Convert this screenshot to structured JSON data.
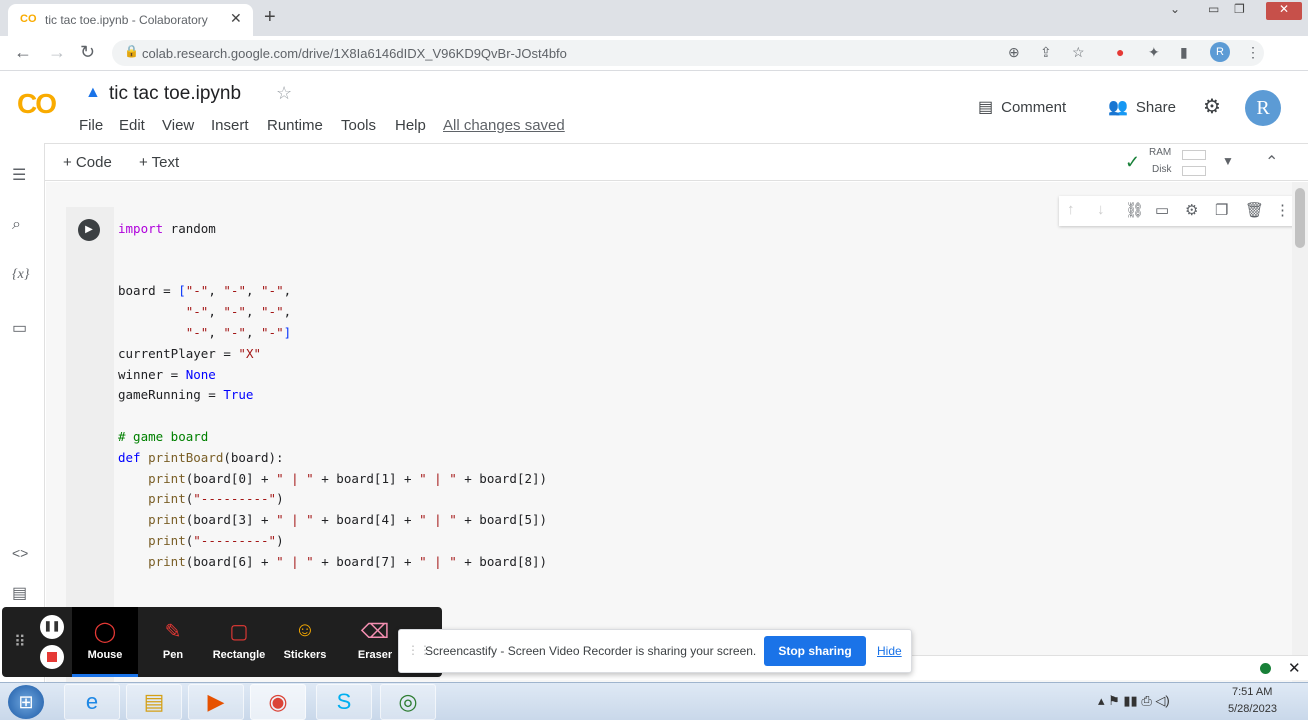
{
  "browser": {
    "tab_title": "tic tac toe.ipynb - Colaboratory",
    "tab_favicon": "CO",
    "url": "colab.research.google.com/drive/1X8Ia6146dIDX_V96KD9QvBr-JOst4bfo"
  },
  "colab": {
    "logo": "CO",
    "notebook_title": "tic tac toe.ipynb",
    "menu": [
      "File",
      "Edit",
      "View",
      "Insert",
      "Runtime",
      "Tools",
      "Help"
    ],
    "saved_status": "All changes saved",
    "comment_label": "Comment",
    "share_label": "Share",
    "avatar_letter": "R",
    "toolbar": {
      "add_code": "+ Code",
      "add_text": "+ Text",
      "ram_label": "RAM",
      "disk_label": "Disk"
    }
  },
  "cell": {
    "code_lines": [
      [
        [
          "kw",
          "import"
        ],
        [
          "",
          " random"
        ]
      ],
      [],
      [],
      [
        [
          "",
          "board = "
        ],
        [
          "br",
          "["
        ],
        [
          "str",
          "\"-\""
        ],
        [
          "",
          ", "
        ],
        [
          "str",
          "\"-\""
        ],
        [
          "",
          ", "
        ],
        [
          "str",
          "\"-\""
        ],
        [
          "",
          ","
        ]
      ],
      [
        [
          "",
          "         "
        ],
        [
          "str",
          "\"-\""
        ],
        [
          "",
          ", "
        ],
        [
          "str",
          "\"-\""
        ],
        [
          "",
          ", "
        ],
        [
          "str",
          "\"-\""
        ],
        [
          "",
          ","
        ]
      ],
      [
        [
          "",
          "         "
        ],
        [
          "str",
          "\"-\""
        ],
        [
          "",
          ", "
        ],
        [
          "str",
          "\"-\""
        ],
        [
          "",
          ", "
        ],
        [
          "str",
          "\"-\""
        ],
        [
          "br",
          "]"
        ]
      ],
      [
        [
          "",
          "currentPlayer = "
        ],
        [
          "str",
          "\"X\""
        ]
      ],
      [
        [
          "",
          "winner = "
        ],
        [
          "kw2",
          "None"
        ]
      ],
      [
        [
          "",
          "gameRunning = "
        ],
        [
          "kw2",
          "True"
        ]
      ],
      [],
      [
        [
          "cm",
          "# game board"
        ]
      ],
      [
        [
          "kw2",
          "def"
        ],
        [
          "",
          " "
        ],
        [
          "fn",
          "printBoard"
        ],
        [
          "",
          "(board):"
        ]
      ],
      [
        [
          "",
          "    "
        ],
        [
          "fn",
          "print"
        ],
        [
          "",
          "(board["
        ],
        [
          "",
          "0"
        ],
        [
          "",
          "] + "
        ],
        [
          "str",
          "\" | \""
        ],
        [
          "",
          " + board["
        ],
        [
          "",
          "1"
        ],
        [
          "",
          "] + "
        ],
        [
          "str",
          "\" | \""
        ],
        [
          "",
          " + board["
        ],
        [
          "",
          "2"
        ],
        [
          "",
          "])"
        ]
      ],
      [
        [
          "",
          "    "
        ],
        [
          "fn",
          "print"
        ],
        [
          "",
          "("
        ],
        [
          "str",
          "\"---------\""
        ],
        [
          "",
          ")"
        ]
      ],
      [
        [
          "",
          "    "
        ],
        [
          "fn",
          "print"
        ],
        [
          "",
          "(board["
        ],
        [
          "",
          "3"
        ],
        [
          "",
          "] + "
        ],
        [
          "str",
          "\" | \""
        ],
        [
          "",
          " + board["
        ],
        [
          "",
          "4"
        ],
        [
          "",
          "] + "
        ],
        [
          "str",
          "\" | \""
        ],
        [
          "",
          " + board["
        ],
        [
          "",
          "5"
        ],
        [
          "",
          "])"
        ]
      ],
      [
        [
          "",
          "    "
        ],
        [
          "fn",
          "print"
        ],
        [
          "",
          "("
        ],
        [
          "str",
          "\"---------\""
        ],
        [
          "",
          ")"
        ]
      ],
      [
        [
          "",
          "    "
        ],
        [
          "fn",
          "print"
        ],
        [
          "",
          "(board["
        ],
        [
          "",
          "6"
        ],
        [
          "",
          "] + "
        ],
        [
          "str",
          "\" | \""
        ],
        [
          "",
          " + board["
        ],
        [
          "",
          "7"
        ],
        [
          "",
          "] + "
        ],
        [
          "str",
          "\" | \""
        ],
        [
          "",
          " + board["
        ],
        [
          "",
          "8"
        ],
        [
          "",
          "])"
        ]
      ]
    ]
  },
  "screencastify": {
    "tools": [
      "Mouse",
      "Pen",
      "Rectangle",
      "Stickers",
      "Eraser"
    ],
    "share_text": "Screencastify - Screen Video Recorder is sharing your screen.",
    "stop_sharing": "Stop sharing",
    "hide": "Hide"
  },
  "taskbar": {
    "time": "7:51 AM",
    "date": "5/28/2023"
  },
  "colors": {
    "colab_orange": "#f9ab00",
    "accent_blue": "#1a73e8",
    "keyword_purple": "#af00db",
    "keyword_blue": "#0000ff",
    "comment_green": "#008000",
    "string_red": "#a31515"
  }
}
